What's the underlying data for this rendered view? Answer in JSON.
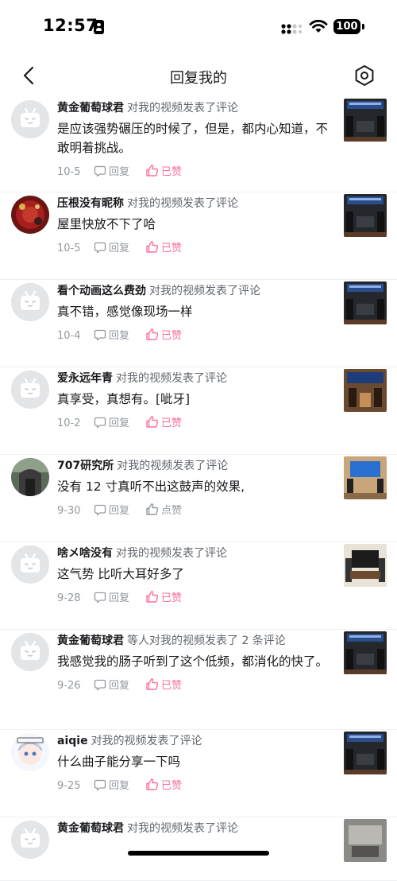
{
  "status_bar": {
    "time": "12:57",
    "battery": "100"
  },
  "nav": {
    "title": "回复我的"
  },
  "items": [
    {
      "username": "黄金葡萄球君",
      "action": "对我的视频发表了评论",
      "comment": "是应该强势碾压的时候了，但是，都内心知道，不敢明着挑战。",
      "date": "10-5",
      "reply_label": "回复",
      "like_label": "已赞",
      "liked": true,
      "avatar_type": "tv",
      "thumb_type": "dark"
    },
    {
      "username": "压根没有昵称",
      "action": "对我的视频发表了评论",
      "comment": "屋里快放不下了哈",
      "date": "10-5",
      "reply_label": "回复",
      "like_label": "已赞",
      "liked": true,
      "avatar_type": "red",
      "thumb_type": "dark"
    },
    {
      "username": "看个动画这么费劲",
      "action": "对我的视频发表了评论",
      "comment": "真不错，感觉像现场一样",
      "date": "10-4",
      "reply_label": "回复",
      "like_label": "已赞",
      "liked": true,
      "avatar_type": "tv",
      "thumb_type": "dark"
    },
    {
      "username": "爱永远年青",
      "action": "对我的视频发表了评论",
      "comment": "真享受，真想有。[呲牙]",
      "date": "10-2",
      "reply_label": "回复",
      "like_label": "已赞",
      "liked": true,
      "avatar_type": "tv",
      "thumb_type": "warm"
    },
    {
      "username": "707研究所",
      "action": "对我的视频发表了评论",
      "comment": "没有 12 寸真听不出这鼓声的效果,",
      "date": "9-30",
      "reply_label": "回复",
      "like_label": "点赞",
      "liked": false,
      "avatar_type": "photo",
      "thumb_type": "room"
    },
    {
      "username": "啥メ啥没有",
      "action": "对我的视频发表了评论",
      "comment": "这气势  比听大耳好多了",
      "date": "9-28",
      "reply_label": "回复",
      "like_label": "已赞",
      "liked": true,
      "avatar_type": "tv",
      "thumb_type": "cabinet"
    },
    {
      "username": "黄金葡萄球君",
      "action": "等人对我的视频发表了 2 条评论",
      "comment": "我感觉我的肠子听到了这个低频，都消化的快了。",
      "date": "9-26",
      "reply_label": "回复",
      "like_label": "已赞",
      "liked": true,
      "avatar_type": "tv",
      "thumb_type": "dark"
    },
    {
      "username": "aiqie",
      "action": "对我的视频发表了评论",
      "comment": "什么曲子能分享一下吗",
      "date": "9-25",
      "reply_label": "回复",
      "like_label": "已赞",
      "liked": true,
      "avatar_type": "anime",
      "thumb_type": "dark"
    },
    {
      "username": "黄金葡萄球君",
      "action": "对我的视频发表了评论",
      "comment": "",
      "date": "",
      "reply_label": "",
      "like_label": "",
      "liked": false,
      "avatar_type": "tv",
      "thumb_type": "gray"
    }
  ],
  "colors": {
    "accent": "#fb7299",
    "muted": "#9499a0",
    "text": "#18191c",
    "divider": "#eef0f2"
  },
  "icons": {
    "back": "chevron-left-icon",
    "settings": "hexagon-gear-icon",
    "reply": "speech-bubble-icon",
    "like": "thumbs-up-icon"
  }
}
